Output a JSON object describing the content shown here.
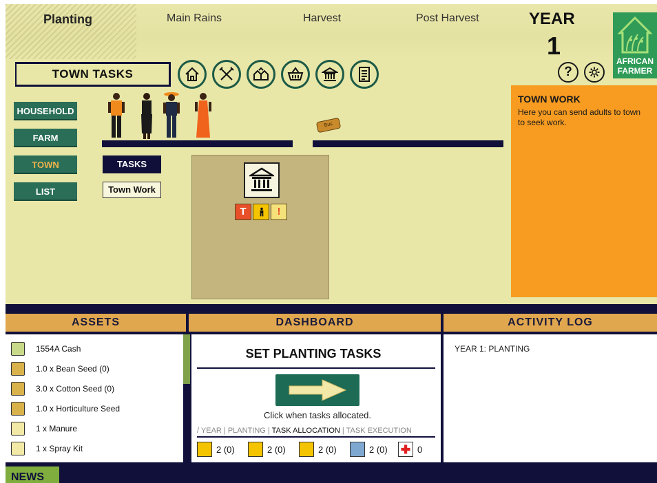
{
  "seasons": [
    "Planting",
    "Main Rains",
    "Harvest",
    "Post Harvest"
  ],
  "year": {
    "label": "YEAR",
    "value": "1"
  },
  "logo": {
    "line1": "AFRICAN",
    "line2": "FARMER"
  },
  "section_title": "TOWN TASKS",
  "nav_icons": [
    "home-icon",
    "farm-tools-icon",
    "village-icon",
    "market-basket-icon",
    "bank-icon",
    "notes-icon"
  ],
  "help_label": "?",
  "left_nav": [
    "HOUSEHOLD",
    "FARM",
    "TOWN",
    "LIST"
  ],
  "active_nav": "TOWN",
  "sub_nav": {
    "tasks": "TASKS",
    "town_work": "Town Work"
  },
  "bus_label": "Bus",
  "plot_icons": [
    "T",
    "person",
    "!"
  ],
  "info": {
    "title": "TOWN WORK",
    "text": "Here you can send adults to town to seek work."
  },
  "panels": {
    "assets": "ASSETS",
    "dashboard": "DASHBOARD",
    "activity": "ACTIVITY LOG"
  },
  "assets": [
    {
      "icon": "cash-icon",
      "label": "1554A Cash"
    },
    {
      "icon": "seed-bag-icon",
      "label": "1.0 x Bean Seed (0)"
    },
    {
      "icon": "seed-bag-icon",
      "label": "3.0 x Cotton Seed (0)"
    },
    {
      "icon": "seed-bag-icon",
      "label": "1.0 x Horticulture Seed"
    },
    {
      "icon": "manure-icon",
      "label": "1 x Manure"
    },
    {
      "icon": "spray-kit-icon",
      "label": "1 x Spray Kit"
    }
  ],
  "dashboard": {
    "title": "SET PLANTING TASKS",
    "click_text": "Click when tasks allocated.",
    "phase_prefix": "/ YEAR | PLANTING | ",
    "phase_active": "TASK ALLOCATION",
    "phase_suffix": " | TASK EXECUTION",
    "counts": [
      {
        "icon": "man-icon",
        "color": "#f5c400",
        "value": "2 (0)"
      },
      {
        "icon": "woman-icon",
        "color": "#f5c400",
        "value": "2 (0)"
      },
      {
        "icon": "child-icon",
        "color": "#f5c400",
        "value": "2 (0)"
      },
      {
        "icon": "elder-icon",
        "color": "#7fa8d0",
        "value": "2 (0)"
      },
      {
        "icon": "sick-cross-icon",
        "color": "#ffffff",
        "value": "0"
      }
    ]
  },
  "activity_log": "YEAR 1: PLANTING",
  "news_label": "NEWS"
}
